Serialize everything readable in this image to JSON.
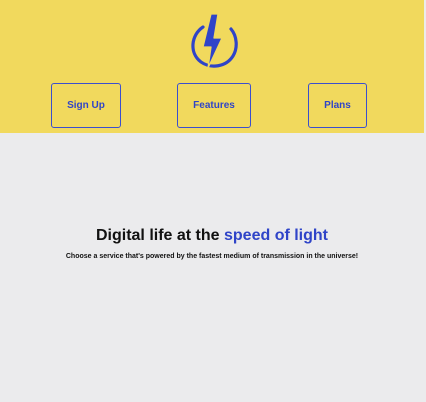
{
  "header": {
    "background_color": "#f1d95d",
    "logo_icon": "lightning-bolt-icon",
    "nav": [
      {
        "label": "Sign Up"
      },
      {
        "label": "Features"
      },
      {
        "label": "Plans"
      }
    ]
  },
  "hero": {
    "title_prefix": "Digital life at the ",
    "title_highlight": "speed of light",
    "subtitle": "Choose a service that's powered by the fastest medium of transmission in the universe!"
  },
  "colors": {
    "accent": "#2f44c8",
    "page_background": "#ebebed",
    "text": "#111111"
  }
}
